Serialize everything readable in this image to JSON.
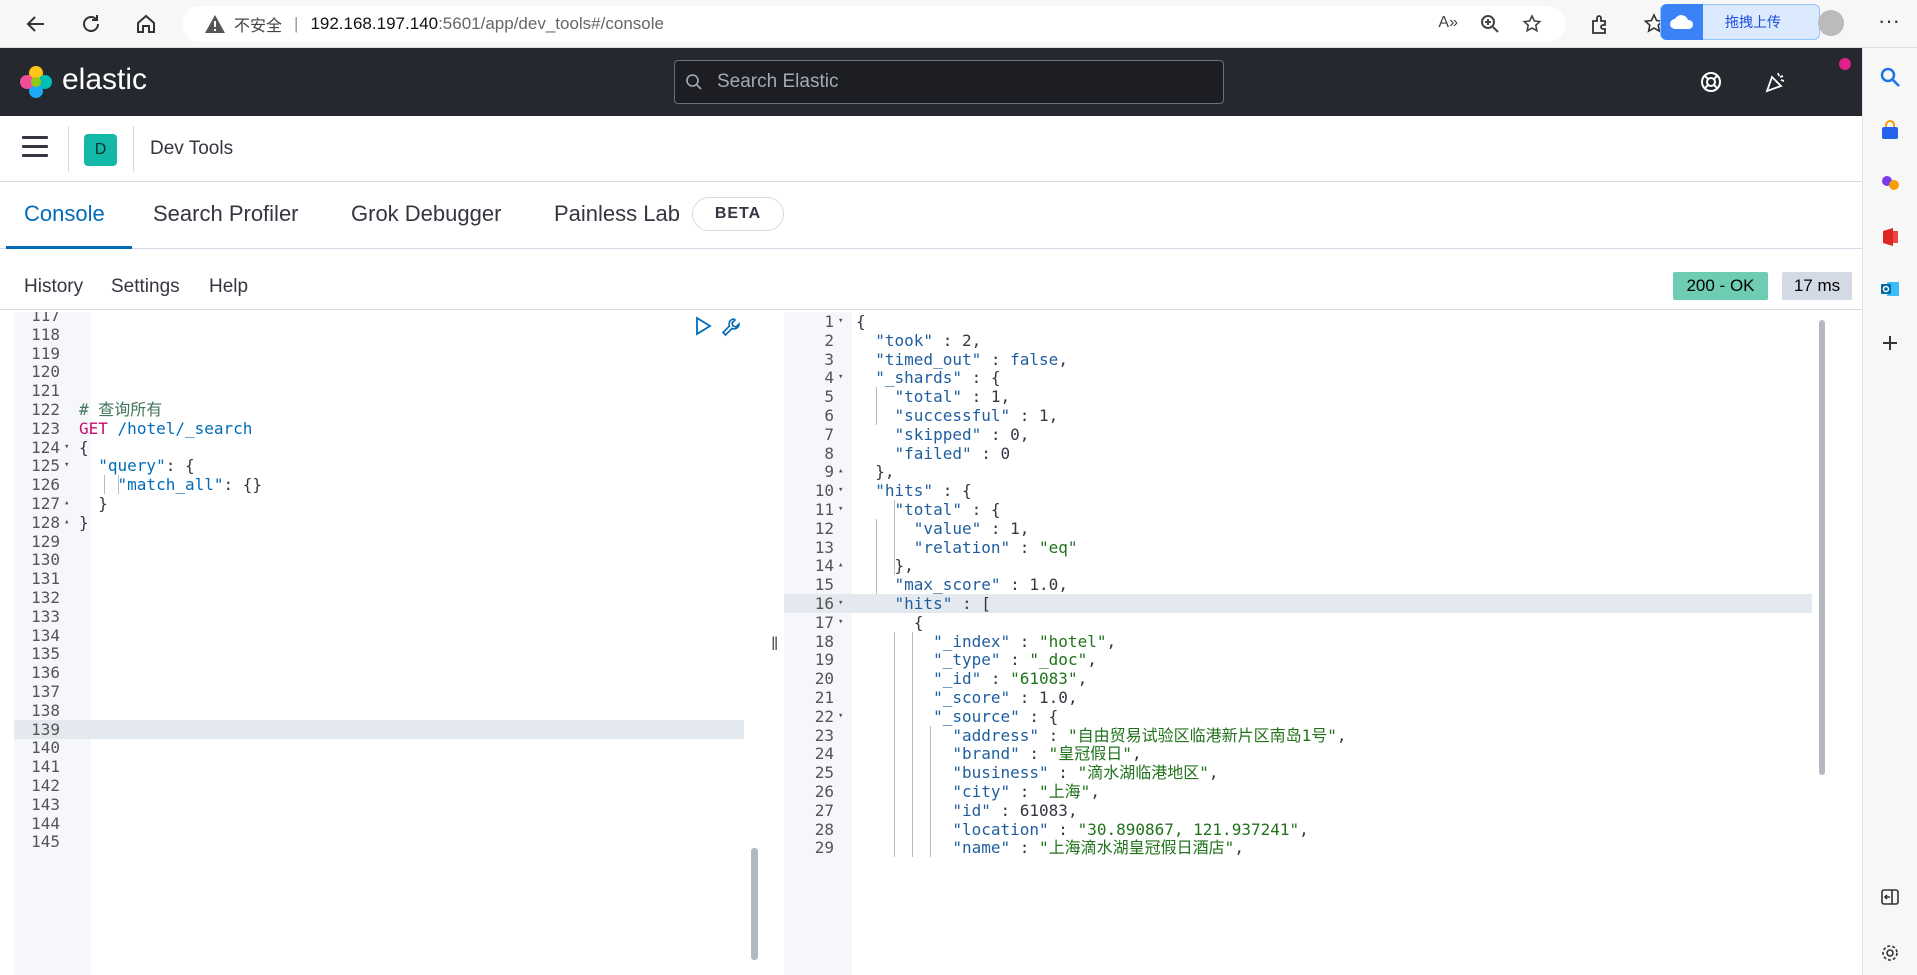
{
  "browser": {
    "insecure_label": "不安全",
    "url_host": "192.168.197.140",
    "url_path": ":5601/app/dev_tools#/console",
    "upload_label": "拖拽上传"
  },
  "header": {
    "brand": "elastic",
    "search_placeholder": "Search Elastic"
  },
  "breadcrumb": {
    "space_initial": "D",
    "title": "Dev Tools"
  },
  "tabs": [
    {
      "label": "Console",
      "active": true
    },
    {
      "label": "Search Profiler"
    },
    {
      "label": "Grok Debugger"
    },
    {
      "label": "Painless Lab"
    }
  ],
  "beta_label": "BETA",
  "submenu": {
    "history": "History",
    "settings": "Settings",
    "help": "Help"
  },
  "status": {
    "code": "200 - OK",
    "time": "17 ms"
  },
  "request_lines": [
    {
      "n": "117",
      "code": ""
    },
    {
      "n": "118",
      "code": ""
    },
    {
      "n": "119",
      "code": ""
    },
    {
      "n": "120",
      "code": ""
    },
    {
      "n": "121",
      "code": ""
    },
    {
      "n": "122",
      "code": "# 查询所有"
    },
    {
      "n": "123",
      "code": "GET /hotel/_search"
    },
    {
      "n": "124",
      "code": "{",
      "fold": "▾"
    },
    {
      "n": "125",
      "code": "  \"query\": {",
      "fold": "▾"
    },
    {
      "n": "126",
      "code": "    \"match_all\": {}"
    },
    {
      "n": "127",
      "code": "  }",
      "fold": "▴"
    },
    {
      "n": "128",
      "code": "}",
      "fold": "▴"
    },
    {
      "n": "129",
      "code": ""
    },
    {
      "n": "130",
      "code": ""
    },
    {
      "n": "131",
      "code": ""
    },
    {
      "n": "132",
      "code": ""
    },
    {
      "n": "133",
      "code": ""
    },
    {
      "n": "134",
      "code": ""
    },
    {
      "n": "135",
      "code": ""
    },
    {
      "n": "136",
      "code": ""
    },
    {
      "n": "137",
      "code": ""
    },
    {
      "n": "138",
      "code": ""
    },
    {
      "n": "139",
      "code": "",
      "highlight": true
    },
    {
      "n": "140",
      "code": ""
    },
    {
      "n": "141",
      "code": ""
    },
    {
      "n": "142",
      "code": ""
    },
    {
      "n": "143",
      "code": ""
    },
    {
      "n": "144",
      "code": ""
    },
    {
      "n": "145",
      "code": ""
    }
  ],
  "response_lines": [
    {
      "n": "1",
      "code": "{",
      "fold": "▾"
    },
    {
      "n": "2",
      "code": "  \"took\" : 2,"
    },
    {
      "n": "3",
      "code": "  \"timed_out\" : false,"
    },
    {
      "n": "4",
      "code": "  \"_shards\" : {",
      "fold": "▾"
    },
    {
      "n": "5",
      "code": "    \"total\" : 1,"
    },
    {
      "n": "6",
      "code": "    \"successful\" : 1,"
    },
    {
      "n": "7",
      "code": "    \"skipped\" : 0,"
    },
    {
      "n": "8",
      "code": "    \"failed\" : 0"
    },
    {
      "n": "9",
      "code": "  },",
      "fold": "▴"
    },
    {
      "n": "10",
      "code": "  \"hits\" : {",
      "fold": "▾"
    },
    {
      "n": "11",
      "code": "    \"total\" : {",
      "fold": "▾"
    },
    {
      "n": "12",
      "code": "      \"value\" : 1,"
    },
    {
      "n": "13",
      "code": "      \"relation\" : \"eq\""
    },
    {
      "n": "14",
      "code": "    },",
      "fold": "▴"
    },
    {
      "n": "15",
      "code": "    \"max_score\" : 1.0,"
    },
    {
      "n": "16",
      "code": "    \"hits\" : [",
      "fold": "▾",
      "highlight": true
    },
    {
      "n": "17",
      "code": "      {",
      "fold": "▾"
    },
    {
      "n": "18",
      "code": "        \"_index\" : \"hotel\","
    },
    {
      "n": "19",
      "code": "        \"_type\" : \"_doc\","
    },
    {
      "n": "20",
      "code": "        \"_id\" : \"61083\","
    },
    {
      "n": "21",
      "code": "        \"_score\" : 1.0,"
    },
    {
      "n": "22",
      "code": "        \"_source\" : {",
      "fold": "▾"
    },
    {
      "n": "23",
      "code": "          \"address\" : \"自由贸易试验区临港新片区南岛1号\","
    },
    {
      "n": "24",
      "code": "          \"brand\" : \"皇冠假日\","
    },
    {
      "n": "25",
      "code": "          \"business\" : \"滴水湖临港地区\","
    },
    {
      "n": "26",
      "code": "          \"city\" : \"上海\","
    },
    {
      "n": "27",
      "code": "          \"id\" : 61083,"
    },
    {
      "n": "28",
      "code": "          \"location\" : \"30.890867, 121.937241\","
    },
    {
      "n": "29",
      "code": "          \"name\" : \"上海滴水湖皇冠假日酒店\","
    }
  ]
}
